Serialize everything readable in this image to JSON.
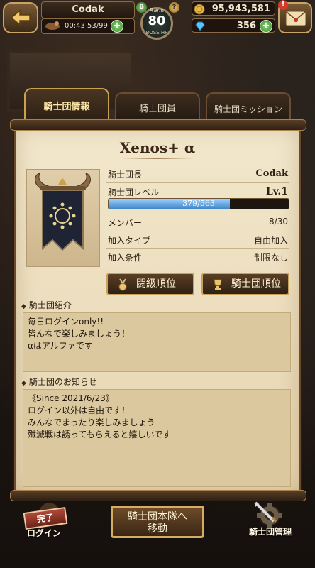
{
  "hud": {
    "player_name": "Codak",
    "stamina_time": "00:43",
    "stamina_value": "53/99",
    "rank_label": "Rank",
    "rank_number": "80",
    "rank_sub": "BOSS HP",
    "gold": "95,943,581",
    "gems": "356",
    "badge_b": "B",
    "badge_q": "?",
    "mail_alert": "!"
  },
  "tabs": [
    {
      "label": "騎士団情報",
      "active": true
    },
    {
      "label": "騎士団員",
      "active": false
    },
    {
      "label": "騎士団ミッション",
      "active": false
    }
  ],
  "knight": {
    "name": "Xenos+ α",
    "rows": {
      "leader_key": "騎士団長",
      "leader_val": "Codak",
      "level_key": "騎士団レベル",
      "level_val": "Lv.1",
      "exp_text": "379/563",
      "exp_fraction": 0.673,
      "member_key": "メンバー",
      "member_val": "8/30",
      "join_type_key": "加入タイプ",
      "join_type_val": "自由加入",
      "join_cond_key": "加入条件",
      "join_cond_val": "制限なし"
    }
  },
  "buttons": {
    "battle_rank": "闘級順位",
    "knight_rank": "騎士団順位",
    "hq_line1": "騎士団本隊へ",
    "hq_line2": "移動",
    "login_tag": "完了",
    "login_label": "ログイン",
    "manage_label": "騎士団管理"
  },
  "intro": {
    "title": "騎士団紹介",
    "lines": [
      "毎日ログインonly!!",
      "皆んなで楽しみましょう！",
      "αはアルファです"
    ]
  },
  "notice": {
    "title": "騎士団のお知らせ",
    "lines": [
      "《Since 2021/6/23》",
      "ログイン以外は自由です！",
      "みんなでまったり楽しみましょう",
      "殲滅戦は誘ってもらえると嬉しいです"
    ]
  },
  "colors": {
    "parchment": "#f2e7cc",
    "exp_fill": "#3f88c8",
    "tab_active_text": "#ffe9a8"
  }
}
